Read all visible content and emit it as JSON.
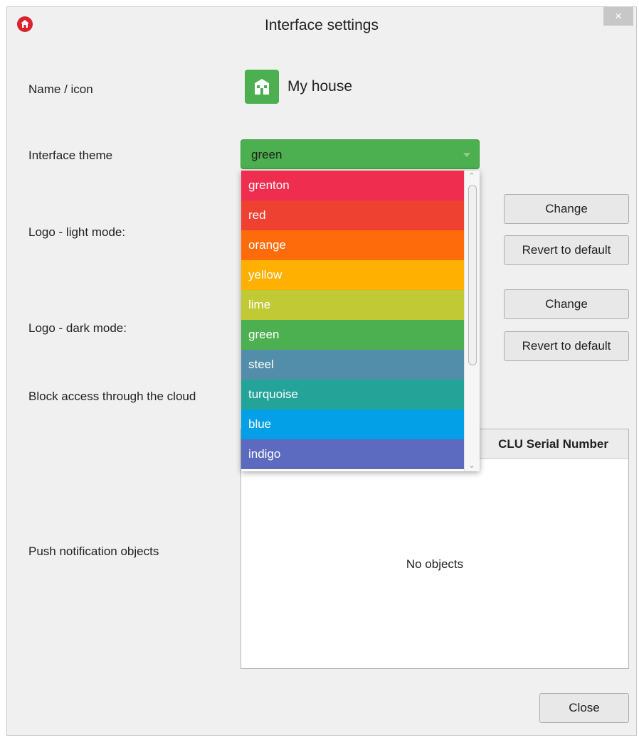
{
  "window": {
    "title": "Interface settings",
    "close_symbol": "×"
  },
  "icons": {
    "app": "home-icon",
    "house": "house-icon"
  },
  "colors": {
    "accent": "#4caf50",
    "app_icon": "#d9232d",
    "themes": {
      "grenton": "#ef2d4e",
      "red": "#ee4132",
      "orange": "#fe6b0a",
      "yellow": "#ffb000",
      "lime": "#c1c934",
      "green": "#4caf50",
      "steel": "#528ea9",
      "turquoise": "#24a498",
      "blue": "#03a0e8",
      "indigo": "#5c6bc0"
    }
  },
  "fields": {
    "name_icon_label": "Name / icon",
    "name_value": "My house",
    "theme_label": "Interface theme",
    "theme_selected": "green",
    "logo_light_label": "Logo - light mode:",
    "logo_dark_label": "Logo - dark mode:",
    "block_cloud_label": "Block access through the cloud",
    "push_label": "Push notification objects"
  },
  "buttons": {
    "change_light": "Change",
    "revert_light": "Revert to default",
    "change_dark": "Change",
    "revert_dark": "Revert to default",
    "close": "Close"
  },
  "theme_options": [
    "grenton",
    "red",
    "orange",
    "yellow",
    "lime",
    "green",
    "steel",
    "turquoise",
    "blue",
    "indigo"
  ],
  "table": {
    "column_header": "CLU Serial Number",
    "empty_text": "No objects"
  }
}
